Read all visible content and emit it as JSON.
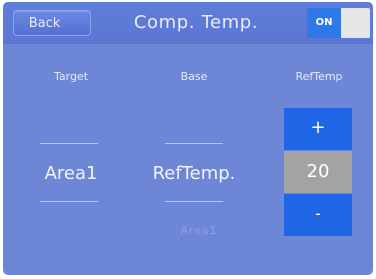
{
  "header": {
    "back_label": "Back",
    "title": "Comp. Temp.",
    "toggle_label": "ON"
  },
  "columns": {
    "target_label": "Target",
    "base_label": "Base",
    "reftemp_label": "RefTemp"
  },
  "values": {
    "target": "Area1",
    "base": "RefTemp.",
    "base_alt": "Area1",
    "reftemp": "20"
  },
  "controls": {
    "plus_label": "+",
    "minus_label": "-"
  },
  "colors": {
    "background": "#6d86d6",
    "header": "#5f7ddc",
    "button_blue": "#1f66e7",
    "value_gray": "#a3a3a3",
    "toggle_on": "#2f78e8"
  }
}
